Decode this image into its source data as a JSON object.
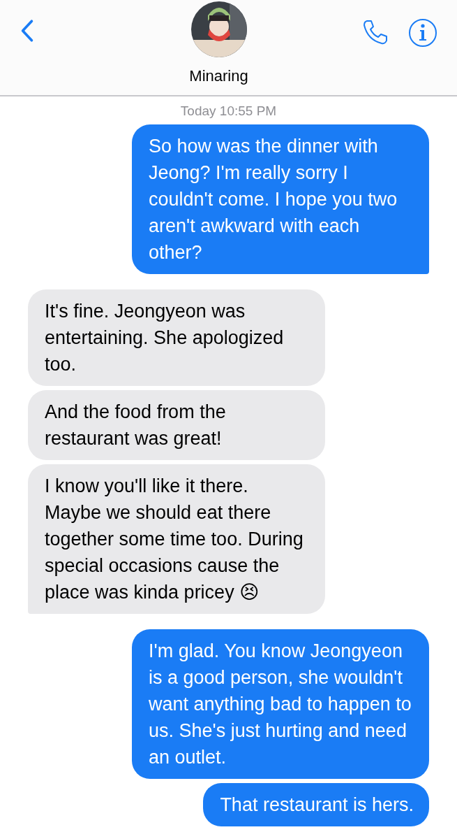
{
  "header": {
    "contact_name": "Minaring"
  },
  "timestamp": "Today 10:55 PM",
  "messages": [
    {
      "kind": "sent",
      "tail": true,
      "text": "So how was the dinner with Jeong? I'm really sorry I couldn't come. I hope you two aren't awkward with each other?"
    },
    {
      "kind": "received",
      "tail": false,
      "text": "It's fine. Jeongyeon was entertaining. She apologized too."
    },
    {
      "kind": "received",
      "tail": false,
      "text": "And the food from the restaurant was great!"
    },
    {
      "kind": "received",
      "tail": true,
      "text": "I know you'll like it there. Maybe we should eat there together some time too. During special occasions cause the place was kinda pricey 😣"
    },
    {
      "kind": "sent",
      "tail": false,
      "text": "I'm glad. You know Jeongyeon is a good person, she wouldn't want anything bad to happen to us. She's just hurting and need an outlet."
    },
    {
      "kind": "sent",
      "tail": false,
      "text": "That restaurant is hers."
    }
  ]
}
